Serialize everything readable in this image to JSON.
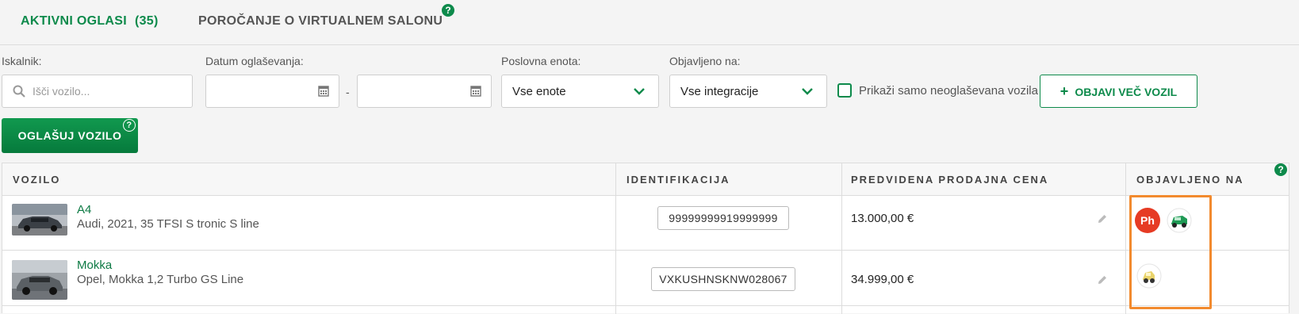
{
  "tabs": {
    "active_label": "AKTIVNI OGLASI",
    "active_count": "(35)",
    "report_label": "POROČANJE O VIRTUALNEM SALONU",
    "help": "?"
  },
  "filters": {
    "search_label": "Iskalnik:",
    "search_placeholder": "Išči vozilo...",
    "date_label": "Datum oglaševanja:",
    "date_separator": "-",
    "unit_label": "Poslovna enota:",
    "unit_value": "Vse enote",
    "published_label": "Objavljeno na:",
    "published_value": "Vse integracije",
    "checkbox_label": "Prikaži samo neoglaševana vozila",
    "publish_more_label": "OBJAVI VEČ VOZIL",
    "publish_more_icon": "plus-icon"
  },
  "actions": {
    "advertise_label": "OGLAŠUJ VOZILO",
    "help": "?"
  },
  "table": {
    "columns": [
      "VOZILO",
      "IDENTIFIKACIJA",
      "PREDVIDENA PRODAJNA CENA",
      "OBJAVLJENO NA"
    ],
    "help": "?",
    "rows": [
      {
        "model": "A4",
        "description": "Audi, 2021, 35 TFSI S tronic S line",
        "id": "99999999919999999",
        "price": "13.000,00 €",
        "published_on": [
          "ph-logo",
          "green-car-logo"
        ]
      },
      {
        "model": "Mokka",
        "description": "Opel, Mokka 1,2 Turbo GS Line",
        "id": "VXKUSHNSKNW028067",
        "price": "34.999,00 €",
        "published_on": [
          "yellow-car-logo"
        ]
      }
    ]
  },
  "colors": {
    "brand_green": "#0d8a4b",
    "highlight_orange": "#f28a2e",
    "ph_red": "#e63b24"
  },
  "logos": {
    "ph_text": "Ph"
  }
}
